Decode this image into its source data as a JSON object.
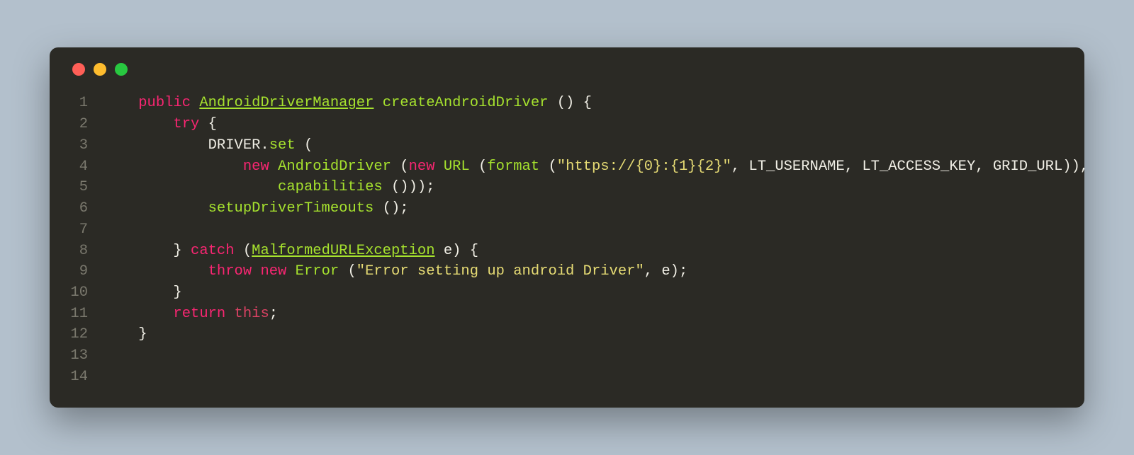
{
  "window": {
    "traffic_lights": [
      "close",
      "minimize",
      "maximize"
    ]
  },
  "code": {
    "language": "java",
    "line_count": 14,
    "lines": [
      {
        "num": "1",
        "indent": "    ",
        "tokens": [
          {
            "t": "public",
            "c": "keyword"
          },
          {
            "t": " ",
            "c": "punct"
          },
          {
            "t": "AndroidDriverManager",
            "c": "type underline"
          },
          {
            "t": " ",
            "c": "punct"
          },
          {
            "t": "createAndroidDriver",
            "c": "func"
          },
          {
            "t": " () {",
            "c": "punct"
          }
        ]
      },
      {
        "num": "2",
        "indent": "        ",
        "tokens": [
          {
            "t": "try",
            "c": "keyword"
          },
          {
            "t": " {",
            "c": "punct"
          }
        ]
      },
      {
        "num": "3",
        "indent": "            ",
        "tokens": [
          {
            "t": "DRIVER.",
            "c": "ident"
          },
          {
            "t": "set",
            "c": "func"
          },
          {
            "t": " (",
            "c": "punct"
          }
        ]
      },
      {
        "num": "4",
        "indent": "                ",
        "tokens": [
          {
            "t": "new",
            "c": "keyword"
          },
          {
            "t": " ",
            "c": "punct"
          },
          {
            "t": "AndroidDriver",
            "c": "func"
          },
          {
            "t": " (",
            "c": "punct"
          },
          {
            "t": "new",
            "c": "keyword"
          },
          {
            "t": " ",
            "c": "punct"
          },
          {
            "t": "URL",
            "c": "func"
          },
          {
            "t": " (",
            "c": "punct"
          },
          {
            "t": "format",
            "c": "func"
          },
          {
            "t": " (",
            "c": "punct"
          },
          {
            "t": "\"https://{0}:{1}{2}\"",
            "c": "string"
          },
          {
            "t": ", LT_USERNAME, LT_ACCESS_KEY, GRID_URL)),",
            "c": "ident"
          }
        ]
      },
      {
        "num": "5",
        "indent": "                    ",
        "tokens": [
          {
            "t": "capabilities",
            "c": "func"
          },
          {
            "t": " ()));",
            "c": "punct"
          }
        ]
      },
      {
        "num": "6",
        "indent": "            ",
        "tokens": [
          {
            "t": "setupDriverTimeouts",
            "c": "func"
          },
          {
            "t": " ();",
            "c": "punct"
          }
        ]
      },
      {
        "num": "7",
        "indent": "",
        "tokens": []
      },
      {
        "num": "8",
        "indent": "        ",
        "tokens": [
          {
            "t": "} ",
            "c": "punct"
          },
          {
            "t": "catch",
            "c": "keyword"
          },
          {
            "t": " (",
            "c": "punct"
          },
          {
            "t": "MalformedURLException",
            "c": "type underline"
          },
          {
            "t": " ",
            "c": "punct"
          },
          {
            "t": "e",
            "c": "param"
          },
          {
            "t": ") {",
            "c": "punct"
          }
        ]
      },
      {
        "num": "9",
        "indent": "            ",
        "tokens": [
          {
            "t": "throw",
            "c": "keyword"
          },
          {
            "t": " ",
            "c": "punct"
          },
          {
            "t": "new",
            "c": "keyword"
          },
          {
            "t": " ",
            "c": "punct"
          },
          {
            "t": "Error",
            "c": "func"
          },
          {
            "t": " (",
            "c": "punct"
          },
          {
            "t": "\"Error setting up android Driver\"",
            "c": "string"
          },
          {
            "t": ", e);",
            "c": "ident"
          }
        ]
      },
      {
        "num": "10",
        "indent": "        ",
        "tokens": [
          {
            "t": "}",
            "c": "punct"
          }
        ]
      },
      {
        "num": "11",
        "indent": "        ",
        "tokens": [
          {
            "t": "return",
            "c": "keyword"
          },
          {
            "t": " ",
            "c": "punct"
          },
          {
            "t": "this",
            "c": "keyword2"
          },
          {
            "t": ";",
            "c": "punct"
          }
        ]
      },
      {
        "num": "12",
        "indent": "    ",
        "tokens": [
          {
            "t": "}",
            "c": "punct"
          }
        ]
      },
      {
        "num": "13",
        "indent": "",
        "tokens": []
      },
      {
        "num": "14",
        "indent": "",
        "tokens": []
      }
    ]
  }
}
